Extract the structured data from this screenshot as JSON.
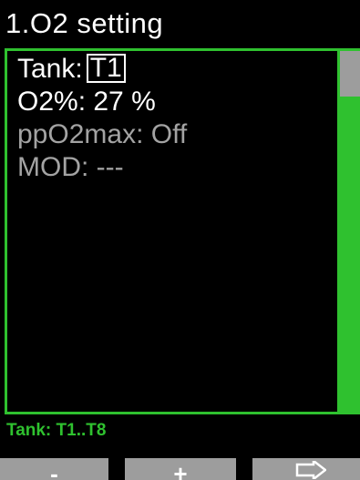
{
  "header": {
    "title": "1.O2 setting"
  },
  "settings": {
    "tank_label": "Tank:",
    "tank_value": "T1",
    "o2_row": "O2%: 27 %",
    "ppo2max_row": "ppO2max: Off",
    "mod_row": "MOD: ---"
  },
  "hint": "Tank: T1..T8",
  "softkeys": {
    "left": "-",
    "center": "+",
    "right_icon": "arrow-right-icon"
  },
  "colors": {
    "accent": "#2fc12f",
    "inactive_text": "#a3a3a3",
    "softkey_bg": "#9d9d9d"
  }
}
